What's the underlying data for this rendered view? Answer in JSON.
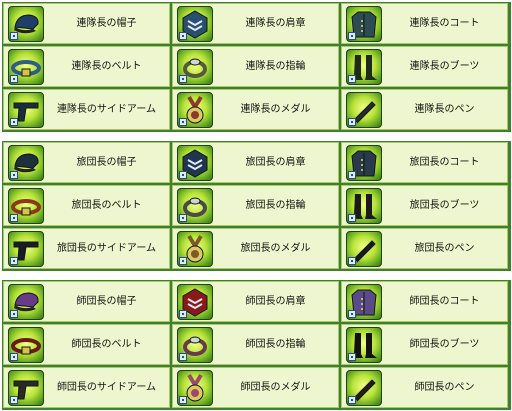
{
  "colors": {
    "frame": "#3f7f2f",
    "cell_bg": "#eef6cf",
    "icon_glow": "#b7e33a"
  },
  "sections": [
    {
      "rank": "regiment",
      "items": [
        {
          "label": "連隊長の帽子",
          "icon": "cap-icon",
          "color": "#1f3f66"
        },
        {
          "label": "連隊長の肩章",
          "icon": "insignia-icon",
          "color": "#2b4f6e"
        },
        {
          "label": "連隊長のコート",
          "icon": "coat-icon",
          "color": "#2d4c54"
        },
        {
          "label": "連隊長のベルト",
          "icon": "belt-icon",
          "color": "#2f5d8a"
        },
        {
          "label": "連隊長の指輪",
          "icon": "ring-icon",
          "color": "#555a3a"
        },
        {
          "label": "連隊長のブーツ",
          "icon": "boots-icon",
          "color": "#1e2a1e"
        },
        {
          "label": "連隊長のサイドアーム",
          "icon": "gun-icon",
          "color": "#1a2d3c"
        },
        {
          "label": "連隊長のメダル",
          "icon": "medal-icon",
          "color": "#8a3b2a"
        },
        {
          "label": "連隊長のペン",
          "icon": "pen-icon",
          "color": "#2a2a2a"
        }
      ]
    },
    {
      "rank": "brigade",
      "items": [
        {
          "label": "旅団長の帽子",
          "icon": "cap-icon",
          "color": "#1f2f3c"
        },
        {
          "label": "旅団長の肩章",
          "icon": "insignia-icon",
          "color": "#1f3550"
        },
        {
          "label": "旅団長のコート",
          "icon": "coat-icon",
          "color": "#2a3a4a"
        },
        {
          "label": "旅団長のベルト",
          "icon": "belt-icon",
          "color": "#8a3a1a"
        },
        {
          "label": "旅団長の指輪",
          "icon": "ring-icon",
          "color": "#4a4a4a"
        },
        {
          "label": "旅団長のブーツ",
          "icon": "boots-icon",
          "color": "#1a1a1a"
        },
        {
          "label": "旅団長のサイドアーム",
          "icon": "gun-icon",
          "color": "#1a1a2a"
        },
        {
          "label": "旅団長のメダル",
          "icon": "medal-icon",
          "color": "#7a5a2a"
        },
        {
          "label": "旅団長のペン",
          "icon": "pen-icon",
          "color": "#1a1a1a"
        }
      ]
    },
    {
      "rank": "division",
      "items": [
        {
          "label": "師団長の帽子",
          "icon": "cap-icon",
          "color": "#6a3a8a"
        },
        {
          "label": "師団長の肩章",
          "icon": "insignia-icon",
          "color": "#8a1a1a"
        },
        {
          "label": "師団長のコート",
          "icon": "coat-icon",
          "color": "#5a4a8a"
        },
        {
          "label": "師団長のベルト",
          "icon": "belt-icon",
          "color": "#6a1a1a"
        },
        {
          "label": "師団長の指輪",
          "icon": "ring-icon",
          "color": "#6a3a4a"
        },
        {
          "label": "師団長のブーツ",
          "icon": "boots-icon",
          "color": "#111111"
        },
        {
          "label": "師団長のサイドアーム",
          "icon": "gun-icon",
          "color": "#2a2a2a"
        },
        {
          "label": "師団長のメダル",
          "icon": "medal-icon",
          "color": "#9a4a6a"
        },
        {
          "label": "師団長のペン",
          "icon": "pen-icon",
          "color": "#2a1a1a"
        }
      ]
    }
  ]
}
